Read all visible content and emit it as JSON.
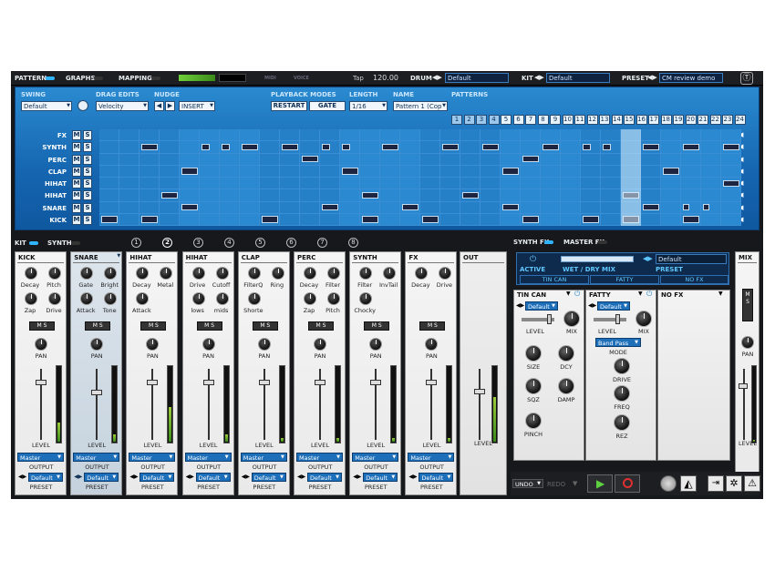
{
  "topbar": {
    "pattern_tab": "PATTERN",
    "graphs_tab": "GRAPHS",
    "mapping_tab": "MAPPING",
    "midi_label": "MIDI",
    "voice_label": "VOICE",
    "tap_label": "Tap",
    "tempo": "120.00",
    "drum_label": "DRUM",
    "drum_preset": "Default",
    "kit_label": "KIT",
    "kit_preset": "Default",
    "preset_label": "PRESET",
    "preset_value": "CM review demo"
  },
  "sequencer": {
    "swing_label": "SWING",
    "swing_value": "Default",
    "drag_edits_label": "DRAG EDITS",
    "drag_edits_value": "Velocity",
    "nudge_label": "NUDGE",
    "nudge_left": "◀",
    "nudge_right": "▶",
    "insert_value": "INSERT",
    "playback_label": "PLAYBACK MODES",
    "restart_label": "RESTART",
    "gate_label": "GATE",
    "length_label": "LENGTH",
    "length_value": "1/16",
    "name_label": "NAME",
    "name_value": "Pattern 1 (Cop",
    "patterns_label": "PATTERNS",
    "patterns": [
      "1",
      "2",
      "3",
      "4",
      "5",
      "6",
      "7",
      "8",
      "9",
      "10",
      "11",
      "12",
      "13",
      "14",
      "15",
      "16",
      "17",
      "18",
      "19",
      "20",
      "21",
      "22",
      "23",
      "24"
    ],
    "active_patterns": [
      0,
      1,
      2,
      3
    ],
    "rows": [
      {
        "name": "FX",
        "m": "M",
        "s": "S"
      },
      {
        "name": "SYNTH",
        "m": "M",
        "s": "S"
      },
      {
        "name": "PERC",
        "m": "M",
        "s": "S"
      },
      {
        "name": "CLAP",
        "m": "M",
        "s": "S"
      },
      {
        "name": "HIHAT",
        "m": "M",
        "s": "S"
      },
      {
        "name": "HIHAT",
        "m": "M",
        "s": "S"
      },
      {
        "name": "SNARE",
        "m": "M",
        "s": "S"
      },
      {
        "name": "KICK",
        "m": "M",
        "s": "S"
      }
    ],
    "steps": 32,
    "playhead_step": 26,
    "notes": [
      [],
      [
        [
          2,
          1
        ],
        [
          5,
          0.6
        ],
        [
          6,
          0.6
        ],
        [
          7,
          1
        ],
        [
          9,
          1
        ],
        [
          11,
          0.6
        ],
        [
          12,
          0.6
        ],
        [
          14,
          1
        ],
        [
          17,
          1
        ],
        [
          19,
          1
        ],
        [
          22,
          1
        ],
        [
          24,
          0.6
        ],
        [
          25,
          0.6
        ],
        [
          27,
          1
        ],
        [
          29,
          1
        ],
        [
          31,
          1
        ]
      ],
      [
        [
          10,
          1
        ],
        [
          21,
          1
        ]
      ],
      [
        [
          4,
          1
        ],
        [
          12,
          1
        ],
        [
          20,
          1
        ],
        [
          28,
          1
        ]
      ],
      [
        [
          31,
          1
        ]
      ],
      [
        [
          3,
          1
        ],
        [
          13,
          1
        ],
        [
          18,
          1
        ],
        [
          26,
          1
        ]
      ],
      [
        [
          4,
          1
        ],
        [
          11,
          1
        ],
        [
          15,
          1
        ],
        [
          20,
          1
        ],
        [
          27,
          1
        ],
        [
          29,
          0.5
        ],
        [
          30,
          0.5
        ]
      ],
      [
        [
          0,
          1
        ],
        [
          2,
          1
        ],
        [
          8,
          1
        ],
        [
          13,
          1
        ],
        [
          16,
          1
        ],
        [
          21,
          1
        ],
        [
          24,
          1
        ],
        [
          26,
          1
        ],
        [
          29,
          1
        ]
      ]
    ]
  },
  "mixer": {
    "kit_tab": "KIT",
    "synth_tab": "SYNTH",
    "channel_numbers": [
      "1",
      "2",
      "3",
      "4",
      "5",
      "6",
      "7",
      "8"
    ],
    "selected_channel": 1,
    "strips": [
      {
        "name": "KICK",
        "knobs": [
          "Decay",
          "Pitch",
          "Zap",
          "Drive"
        ],
        "level": 0.25,
        "fader": 0.15
      },
      {
        "name": "SNARE",
        "knobs": [
          "Gate",
          "Bright",
          "Attack",
          "Tone"
        ],
        "level": 0.1,
        "fader": 0.3
      },
      {
        "name": "HIHAT",
        "knobs": [
          "Decay",
          "Metal",
          "Attack"
        ],
        "level": 0.45,
        "fader": 0.15
      },
      {
        "name": "HIHAT",
        "knobs": [
          "Drive",
          "Cutoff",
          "lows",
          "mids"
        ],
        "level": 0.1,
        "fader": 0.15
      },
      {
        "name": "CLAP",
        "knobs": [
          "FilterQ",
          "Ring",
          "Shorte"
        ],
        "level": 0.05,
        "fader": 0.15
      },
      {
        "name": "PERC",
        "knobs": [
          "Decay",
          "Filter",
          "Zap",
          "Pitch"
        ],
        "level": 0.05,
        "fader": 0.15
      },
      {
        "name": "SYNTH",
        "knobs": [
          "Filter",
          "InvTail",
          "Chocky"
        ],
        "level": 0.05,
        "fader": 0.15
      },
      {
        "name": "FX",
        "knobs": [
          "Decay",
          "Drive"
        ],
        "level": 0.05,
        "fader": 0.15
      }
    ],
    "out_label": "OUT",
    "pan_label": "PAN",
    "level_label": "LEVEL",
    "output_label": "OUTPUT",
    "preset_label": "PRESET",
    "output_value": "Master",
    "preset_value": "Default",
    "ms_text": "M S"
  },
  "fx": {
    "synth_fx_tab": "SYNTH FX",
    "master_fx_tab": "MASTER FX",
    "active_label": "ACTIVE",
    "wet_dry_label": "WET / DRY MIX",
    "preset_value": "Default",
    "preset_label": "PRESET",
    "slots": [
      "TIN CAN",
      "FATTY",
      "NO FX"
    ],
    "tincan": {
      "title": "TIN CAN",
      "preset": "Default",
      "knobs": [
        "SIZE",
        "DCY",
        "SQZ",
        "DAMP",
        "PINCH"
      ]
    },
    "fatty": {
      "title": "FATTY",
      "preset": "Default",
      "mode_value": "Band Pass",
      "mode_label": "MODE",
      "knobs": [
        "DRIVE",
        "FREQ",
        "REZ"
      ]
    },
    "nofx": {
      "title": "NO FX"
    },
    "level_label": "LEVEL",
    "mix_label": "MIX"
  },
  "mixstrip": {
    "title": "MIX",
    "ms": "M S",
    "pan": "PAN",
    "level": "LEVEL"
  },
  "bottom": {
    "undo": "UNDO",
    "redo": "REDO"
  }
}
